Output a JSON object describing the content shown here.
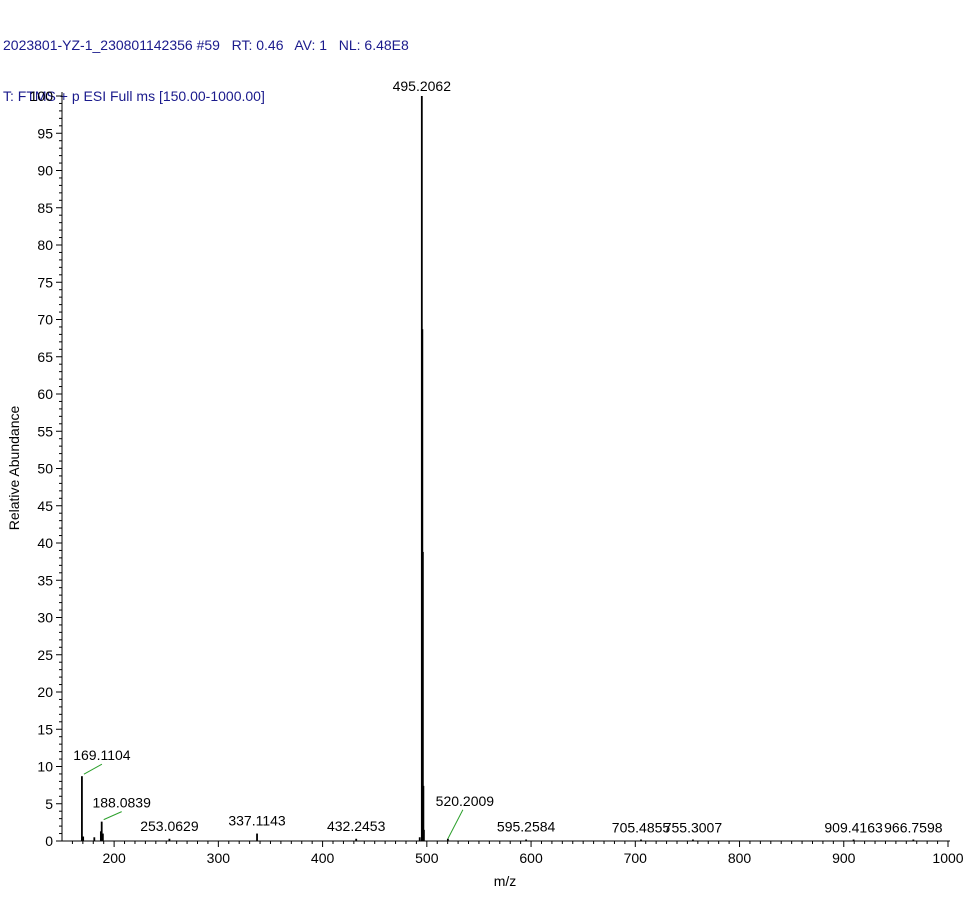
{
  "header": {
    "line1": "2023801-YZ-1_230801142356 #59   RT: 0.46   AV: 1   NL: 6.48E8",
    "line2": "T: FTMS + p ESI Full ms [150.00-1000.00]"
  },
  "colors": {
    "header_text": "#1a1a8c",
    "peak": "#000000",
    "annotation_leader": "#2ca02c"
  },
  "chart_data": {
    "type": "bar",
    "xlabel": "m/z",
    "ylabel": "Relative Abundance",
    "xlim": [
      150,
      1000
    ],
    "ylim": [
      0,
      100
    ],
    "x_ticks": [
      200,
      300,
      400,
      500,
      600,
      700,
      800,
      900,
      1000
    ],
    "y_ticks": [
      0,
      5,
      10,
      15,
      20,
      25,
      30,
      35,
      40,
      45,
      50,
      55,
      60,
      65,
      70,
      75,
      80,
      85,
      90,
      95,
      100
    ],
    "grid": false,
    "peaks": [
      {
        "x": 169.1104,
        "y": 8.7
      },
      {
        "x": 188.0839,
        "y": 2.6
      },
      {
        "x": 187.3,
        "y": 1.3
      },
      {
        "x": 189.2,
        "y": 1.0
      },
      {
        "x": 170.3,
        "y": 0.6
      },
      {
        "x": 181.0,
        "y": 0.5
      },
      {
        "x": 253.0629,
        "y": 0.3
      },
      {
        "x": 337.1143,
        "y": 1.0
      },
      {
        "x": 432.2453,
        "y": 0.3
      },
      {
        "x": 493.2,
        "y": 0.5
      },
      {
        "x": 495.2062,
        "y": 100
      },
      {
        "x": 495.7,
        "y": 68.7
      },
      {
        "x": 496.2,
        "y": 38.8
      },
      {
        "x": 496.7,
        "y": 7.4
      },
      {
        "x": 497.2,
        "y": 1.5
      },
      {
        "x": 520.2009,
        "y": 0.3
      },
      {
        "x": 595.2584,
        "y": 0.2
      },
      {
        "x": 705.4855,
        "y": 0.1
      },
      {
        "x": 755.3007,
        "y": 0.1
      },
      {
        "x": 909.4163,
        "y": 0.1
      },
      {
        "x": 966.7598,
        "y": 0.1
      }
    ],
    "annotations": [
      {
        "label": "495.2062",
        "x": 495.2062,
        "y": 100
      },
      {
        "label": "169.1104",
        "x": 169.1104,
        "y": 8.7
      },
      {
        "label": "188.0839",
        "x": 188.0839,
        "y": 2.6
      },
      {
        "label": "253.0629",
        "x": 253.0629,
        "y": 0.3
      },
      {
        "label": "337.1143",
        "x": 337.1143,
        "y": 1.0
      },
      {
        "label": "432.2453",
        "x": 432.2453,
        "y": 0.3
      },
      {
        "label": "520.2009",
        "x": 520.2009,
        "y": 0.3
      },
      {
        "label": "595.2584",
        "x": 595.2584,
        "y": 0.2
      },
      {
        "label": "705.4855",
        "x": 705.4855,
        "y": 0.1
      },
      {
        "label": "755.3007",
        "x": 755.3007,
        "y": 0.1
      },
      {
        "label": "909.4163",
        "x": 909.4163,
        "y": 0.1
      },
      {
        "label": "966.7598",
        "x": 966.7598,
        "y": 0.1
      }
    ]
  }
}
